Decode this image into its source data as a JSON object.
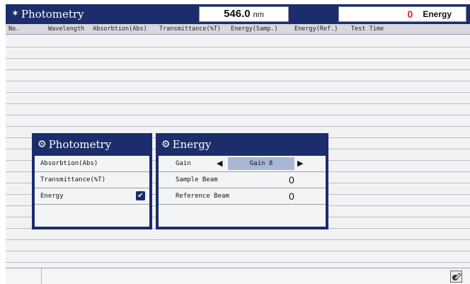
{
  "titlebar": {
    "title": "Photometry",
    "wavelength_value": "546.0",
    "wavelength_unit": "nm",
    "energy_value": "0",
    "energy_label": "Energy"
  },
  "columns": [
    "No.",
    "Wavelength",
    "Absorbtion(Abs)",
    "Transmittance(%T)",
    "Energy(Samp.)",
    "Energy(Ref.)",
    "Test Time"
  ],
  "photometry_panel": {
    "title": "Photometry",
    "items": [
      {
        "label": "Absorbtion(Abs)",
        "checked": false
      },
      {
        "label": "Transmittance(%T)",
        "checked": false
      },
      {
        "label": "Energy",
        "checked": true
      }
    ]
  },
  "energy_panel": {
    "title": "Energy",
    "gain_label": "Gain",
    "gain_value": "Gain 8",
    "sample_beam_label": "Sample Beam",
    "sample_beam_value": "0",
    "reference_beam_label": "Reference Beam",
    "reference_beam_value": "0"
  },
  "icons": {
    "titlebar": "star-icon",
    "panel": "gear-icon",
    "checkbox": "checkmark-icon",
    "gain_prev": "triangle-left-icon",
    "gain_next": "triangle-right-icon",
    "status": "edit-icon"
  },
  "colors": {
    "titlebar_bg": "#1c2d6b",
    "energy_value": "#e02020",
    "gain_highlight": "#a9b7d6"
  }
}
